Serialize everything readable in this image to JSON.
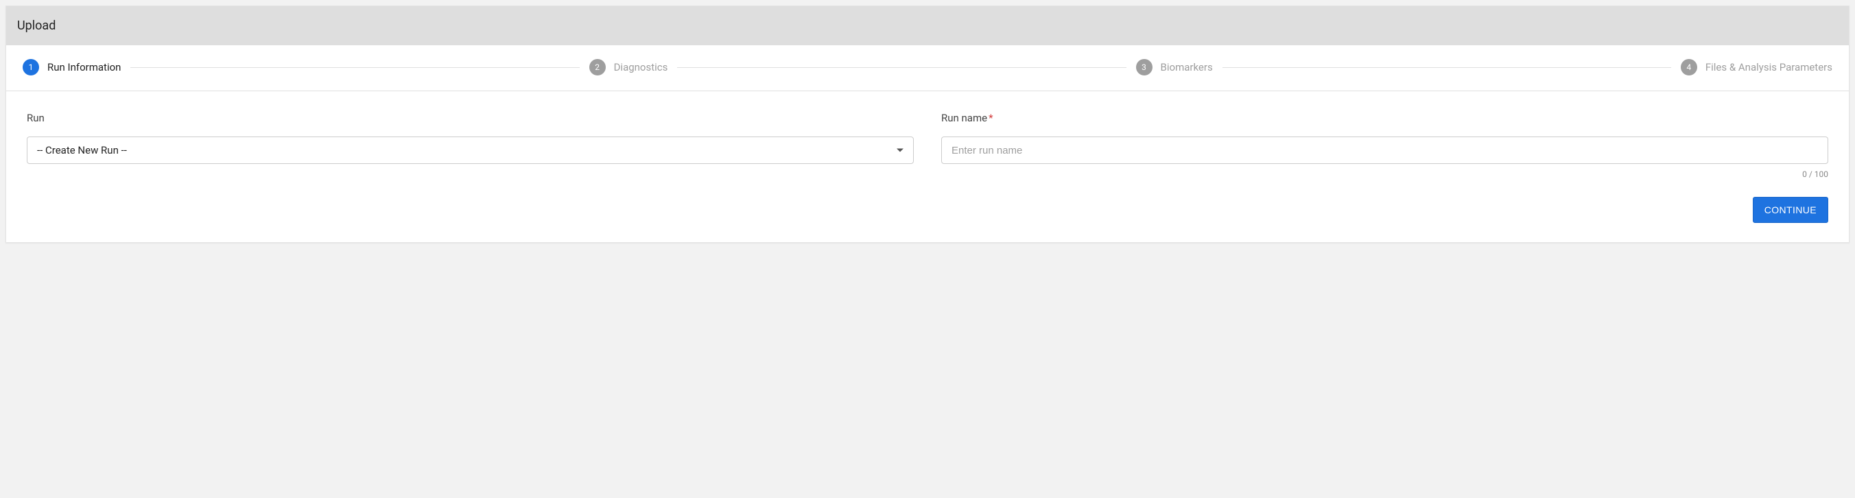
{
  "header": {
    "title": "Upload"
  },
  "stepper": {
    "steps": [
      {
        "num": "1",
        "label": "Run Information"
      },
      {
        "num": "2",
        "label": "Diagnostics"
      },
      {
        "num": "3",
        "label": "Biomarkers"
      },
      {
        "num": "4",
        "label": "Files & Analysis Parameters"
      }
    ],
    "activeIndex": 0
  },
  "form": {
    "run": {
      "label": "Run",
      "selected": "-- Create New Run --"
    },
    "runName": {
      "label": "Run name",
      "required": "*",
      "placeholder": "Enter run name",
      "value": "",
      "counter": "0 / 100"
    }
  },
  "actions": {
    "continue": "CONTINUE"
  }
}
